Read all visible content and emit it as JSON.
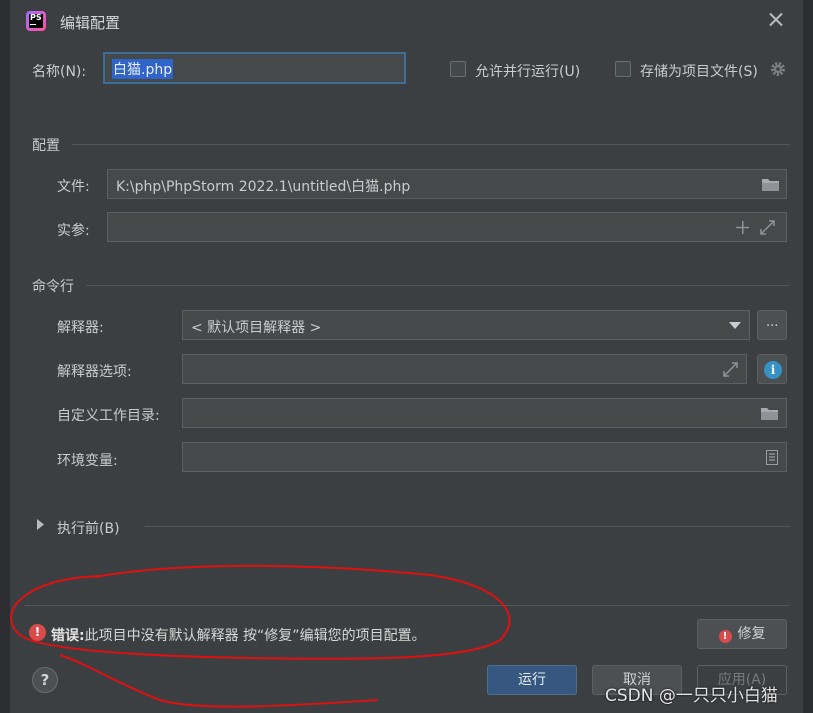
{
  "title": "编辑配置",
  "name": {
    "label": "名称(N):",
    "value": "白猫.php"
  },
  "options": {
    "parallel": "允许并行运行(U)",
    "store": "存储为项目文件(S)"
  },
  "config": {
    "section": "配置",
    "file_label": "文件:",
    "file_value": "K:\\php\\PhpStorm 2022.1\\untitled\\白猫.php",
    "args_label": "实参:",
    "args_value": ""
  },
  "cmdline": {
    "section": "命令行",
    "interpreter_label": "解释器:",
    "interpreter_value": "< 默认项目解释器 >",
    "interp_options_label": "解释器选项:",
    "workdir_label": "自定义工作目录:",
    "env_label": "环境变量:",
    "more_button": "..."
  },
  "before": {
    "label": "执行前(B)"
  },
  "error": {
    "prefix": "错误:",
    "message": "此项目中没有默认解释器 按“修复”编辑您的项目配置。"
  },
  "buttons": {
    "fix": "修复",
    "run": "运行",
    "cancel": "取消",
    "apply": "应用(A)",
    "help": "?"
  },
  "watermark": "CSDN @一只只小白猫",
  "colors": {
    "primary": "#365880",
    "error": "#d94b4b",
    "annotation": "#e01010",
    "info": "#3592c4"
  }
}
